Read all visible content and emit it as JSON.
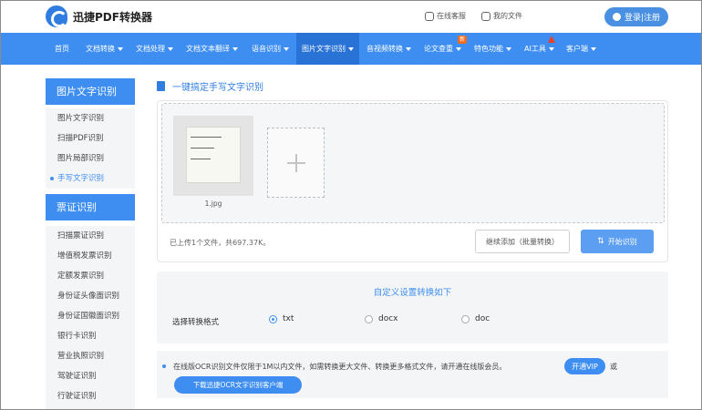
{
  "header": {
    "logo_text": "迅捷PDF转换器",
    "online_service": "在线客服",
    "my_files": "我的文件",
    "login": "登录|注册"
  },
  "nav": {
    "items": [
      {
        "label": "首页"
      },
      {
        "label": "文档转换"
      },
      {
        "label": "文档处理"
      },
      {
        "label": "文档文本翻译"
      },
      {
        "label": "语音识别"
      },
      {
        "label": "图片文字识别"
      },
      {
        "label": "音视频转换"
      },
      {
        "label": "论文查重",
        "badge": "新"
      },
      {
        "label": "特色功能"
      },
      {
        "label": "AI工具"
      },
      {
        "label": "客户端"
      }
    ],
    "active": "图片文字识别"
  },
  "sidebar": {
    "section1_title": "图片文字识别",
    "section1_items": [
      "图片文字识别",
      "扫描PDF识别",
      "图片局部识别",
      "手写文字识别"
    ],
    "active_item": "手写文字识别",
    "section2_title": "票证识别",
    "section2_items": [
      "扫描票证识别",
      "增值税发票识别",
      "定额发票识别",
      "身份证头像面识别",
      "身份证国徽面识别",
      "银行卡识别",
      "营业执照识别",
      "驾驶证识别",
      "行驶证识别"
    ]
  },
  "main": {
    "title": "一键搞定手写文字识别",
    "file_name": "1.jpg",
    "upload_status": "已上传1个文件，共697.37K。",
    "continue_add": "继续添加（批量转换）",
    "start": "开始识别",
    "settings_title": "自定义设置转换如下",
    "format_label": "选择转换格式",
    "formats": [
      "txt",
      "docx",
      "doc"
    ],
    "selected_format": "txt",
    "notice": "在线版OCR识别文件仅限于1M以内文件，如需转换更大文件、转换更多格式文件，请开通在线版会员。",
    "vip_button": "开通VIP",
    "or_text": "或",
    "client_button": "下载迅捷OCR文字识别客户端"
  },
  "colors": {
    "primary": "#3d8ef0",
    "nav_active": "#2a73d6",
    "badge_new": "#f26b1d"
  }
}
